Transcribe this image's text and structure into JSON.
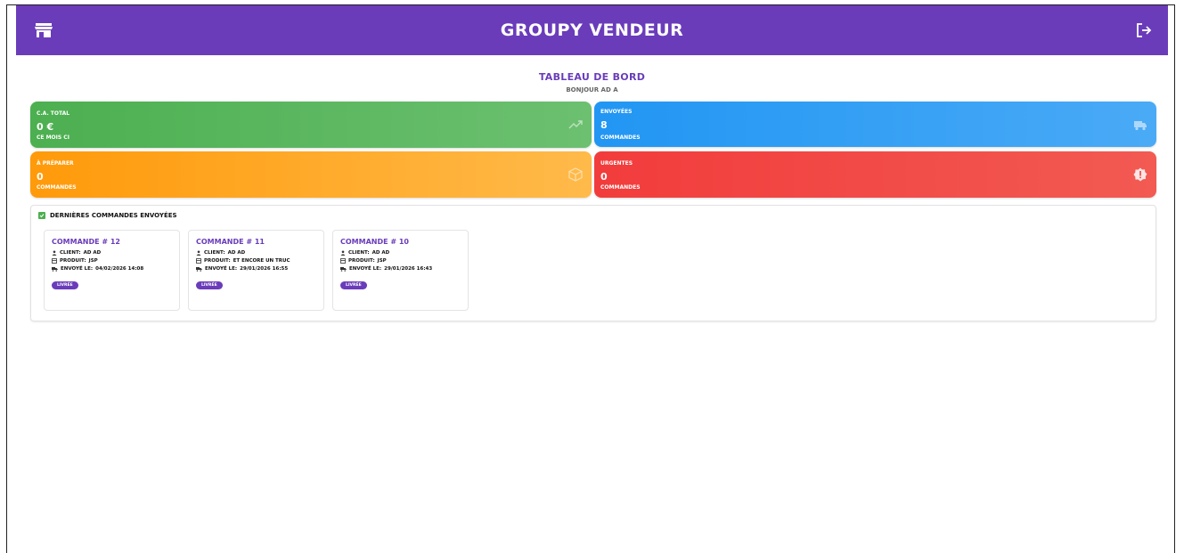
{
  "app": {
    "title": "GROUPY VENDEUR"
  },
  "heading": {
    "title": "TABLEAU DE BORD",
    "greeting": "BONJOUR AD A"
  },
  "stats": {
    "revenue": {
      "label": "C.A. TOTAL",
      "value": "0 €",
      "sub": "CE MOIS CI"
    },
    "sent": {
      "label": "ENVOYÉES",
      "value": "8",
      "sub": "COMMANDES"
    },
    "prepare": {
      "label": "À PRÉPARER",
      "value": "0",
      "sub": "COMMANDES"
    },
    "urgent": {
      "label": "URGENTES",
      "value": "0",
      "sub": "COMMANDES"
    }
  },
  "recent": {
    "title": "DERNIÈRES COMMANDES ENVOYÉES",
    "orders": [
      {
        "title": "COMMANDE # 12",
        "client_label": "CLIENT:",
        "client": "AD AD",
        "product_label": "PRODUIT:",
        "product": "JSP",
        "sent_label": "ENVOYÉ LE:",
        "sent": "04/02/2026 14:08",
        "status": "LIVRÉE"
      },
      {
        "title": "COMMANDE # 11",
        "client_label": "CLIENT:",
        "client": "AD AD",
        "product_label": "PRODUIT:",
        "product": "ET ENCORE UN TRUC",
        "sent_label": "ENVOYÉ LE:",
        "sent": "29/01/2026 16:55",
        "status": "LIVRÉE"
      },
      {
        "title": "COMMANDE # 10",
        "client_label": "CLIENT:",
        "client": "AD AD",
        "product_label": "PRODUIT:",
        "product": "JSP",
        "sent_label": "ENVOYÉ LE:",
        "sent": "29/01/2026 16:43",
        "status": "LIVRÉE"
      }
    ]
  },
  "colors": {
    "brand": "#6a3cba",
    "green": "#4caf50",
    "blue": "#2196f3",
    "orange": "#ff9a0a",
    "red": "#f23c3c"
  }
}
